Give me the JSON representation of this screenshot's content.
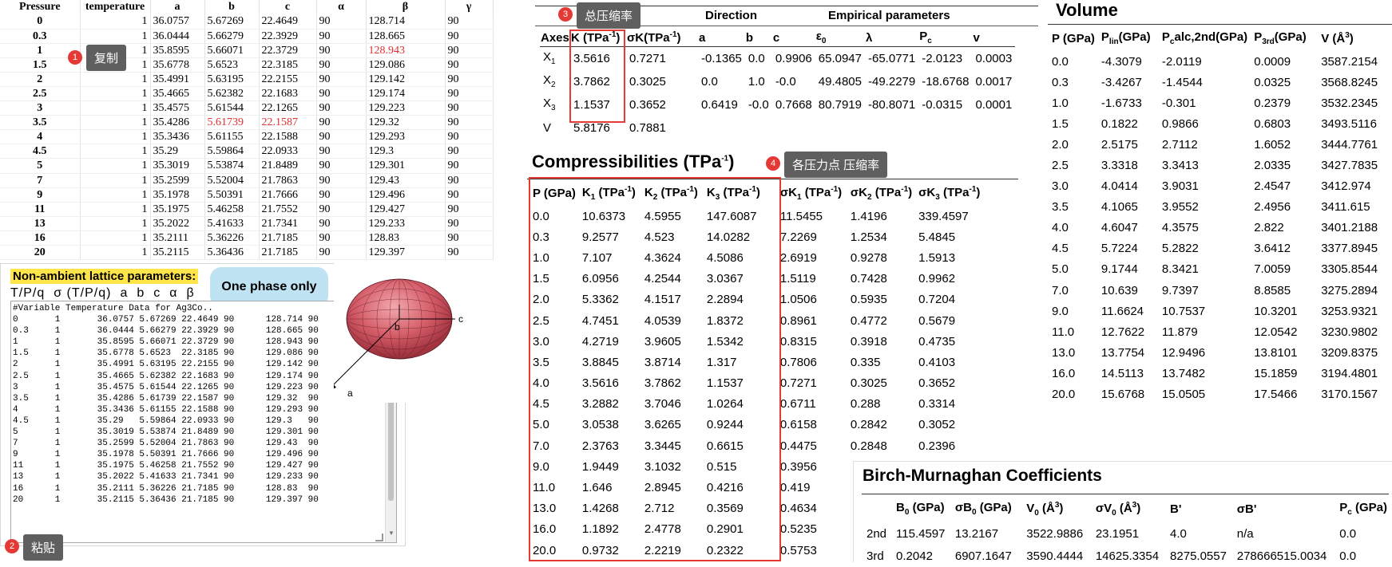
{
  "sheet": {
    "headers": [
      "Pressure",
      "temperature",
      "a",
      "b",
      "c",
      "α",
      "β",
      "γ"
    ],
    "rows": [
      [
        "0",
        "1",
        "36.0757",
        "5.67269",
        "22.4649",
        "90",
        "128.714",
        "90"
      ],
      [
        "0.3",
        "1",
        "36.0444",
        "5.66279",
        "22.3929",
        "90",
        "128.665",
        "90"
      ],
      [
        "1",
        "1",
        "35.8595",
        "5.66071",
        "22.3729",
        "90",
        "128.943",
        "90"
      ],
      [
        "1.5",
        "1",
        "35.6778",
        "5.6523",
        "22.3185",
        "90",
        "129.086",
        "90"
      ],
      [
        "2",
        "1",
        "35.4991",
        "5.63195",
        "22.2155",
        "90",
        "129.142",
        "90"
      ],
      [
        "2.5",
        "1",
        "35.4665",
        "5.62382",
        "22.1683",
        "90",
        "129.174",
        "90"
      ],
      [
        "3",
        "1",
        "35.4575",
        "5.61544",
        "22.1265",
        "90",
        "129.223",
        "90"
      ],
      [
        "3.5",
        "1",
        "35.4286",
        "5.61739",
        "22.1587",
        "90",
        "129.32",
        "90"
      ],
      [
        "4",
        "1",
        "35.3436",
        "5.61155",
        "22.1588",
        "90",
        "129.293",
        "90"
      ],
      [
        "4.5",
        "1",
        "35.29",
        "5.59864",
        "22.0933",
        "90",
        "129.3",
        "90"
      ],
      [
        "5",
        "1",
        "35.3019",
        "5.53874",
        "21.8489",
        "90",
        "129.301",
        "90"
      ],
      [
        "7",
        "1",
        "35.2599",
        "5.52004",
        "21.7863",
        "90",
        "129.43",
        "90"
      ],
      [
        "9",
        "1",
        "35.1978",
        "5.50391",
        "21.7666",
        "90",
        "129.496",
        "90"
      ],
      [
        "11",
        "1",
        "35.1975",
        "5.46258",
        "21.7552",
        "90",
        "129.427",
        "90"
      ],
      [
        "13",
        "1",
        "35.2022",
        "5.41633",
        "21.7341",
        "90",
        "129.233",
        "90"
      ],
      [
        "16",
        "1",
        "35.2111",
        "5.36226",
        "21.7185",
        "90",
        "128.83",
        "90"
      ],
      [
        "20",
        "1",
        "35.2115",
        "5.36436",
        "21.7185",
        "90",
        "129.397",
        "90"
      ]
    ]
  },
  "annotations": {
    "copy": {
      "num": "1",
      "label": "复制"
    },
    "paste": {
      "num": "2",
      "label": "粘贴"
    },
    "total": {
      "num": "3",
      "label": "总压缩率"
    },
    "axial": {
      "num": "4",
      "label": "各压力点 压缩率"
    }
  },
  "nonambient": {
    "title": "Non-ambient lattice parameters:",
    "columns": [
      "T/P/q",
      "σ (T/P/q)",
      "a",
      "b",
      "c",
      "α",
      "β"
    ],
    "bubble": "One phase only",
    "textarea": "#Variable Temperature Data for Ag3Co..\n0       1       36.0757 5.67269 22.4649 90      128.714 90\n0.3     1       36.0444 5.66279 22.3929 90      128.665 90\n1       1       35.8595 5.66071 22.3729 90      128.943 90\n1.5     1       35.6778 5.6523  22.3185 90      129.086 90\n2       1       35.4991 5.63195 22.2155 90      129.142 90\n2.5     1       35.4665 5.62382 22.1683 90      129.174 90\n3       1       35.4575 5.61544 22.1265 90      129.223 90\n3.5     1       35.4286 5.61739 22.1587 90      129.32  90\n4       1       35.3436 5.61155 22.1588 90      129.293 90\n4.5     1       35.29   5.59864 22.0933 90      129.3   90\n5       1       35.3019 5.53874 21.8489 90      129.301 90\n7       1       35.2599 5.52004 21.7863 90      129.43  90\n9       1       35.1978 5.50391 21.7666 90      129.496 90\n11      1       35.1975 5.46258 21.7552 90      129.427 90\n13      1       35.2022 5.41633 21.7341 90      129.233 90\n16      1       35.2111 5.36226 21.7185 90      128.83  90\n20      1       35.2115 5.36436 21.7185 90      129.397 90"
  },
  "ellipsoid": {
    "label_a": "a",
    "label_b": "b",
    "label_c": "c"
  },
  "principal": {
    "group_direction": "Direction",
    "group_empirical": "Empirical parameters",
    "headers": [
      "Axes",
      "K (TPa-1)",
      "σK(TPa-1)",
      "a",
      "b",
      "c",
      "ε0",
      "λ",
      "Pc",
      "v"
    ],
    "rows": [
      [
        "X1",
        "3.5616",
        "0.7271",
        "-0.1365",
        "0.0",
        "0.9906",
        "65.0947",
        "-65.0771",
        "-2.0123",
        "0.0003"
      ],
      [
        "X2",
        "3.7862",
        "0.3025",
        "0.0",
        "1.0",
        "-0.0",
        "49.4805",
        "-49.2279",
        "-18.6768",
        "0.0017"
      ],
      [
        "X3",
        "1.1537",
        "0.3652",
        "0.6419",
        "-0.0",
        "0.7668",
        "80.7919",
        "-80.8071",
        "-0.0315",
        "0.0001"
      ],
      [
        "V",
        "5.8176",
        "0.7881",
        "",
        "",
        "",
        "",
        "",
        "",
        ""
      ]
    ]
  },
  "compress": {
    "title": "Compressibilities (TPa-1)",
    "headers": [
      "P (GPa)",
      "K1 (TPa-1)",
      "K2 (TPa-1)",
      "K3 (TPa-1)",
      "σK1 (TPa-1)",
      "σK2 (TPa-1)",
      "σK3 (TPa-1)"
    ],
    "rows": [
      [
        "0.0",
        "10.6373",
        "4.5955",
        "147.6087",
        "11.5455",
        "1.4196",
        "339.4597"
      ],
      [
        "0.3",
        "9.2577",
        "4.523",
        "14.0282",
        "7.2269",
        "1.2534",
        "5.4845"
      ],
      [
        "1.0",
        "7.107",
        "4.3624",
        "4.5086",
        "2.6919",
        "0.9278",
        "1.5913"
      ],
      [
        "1.5",
        "6.0956",
        "4.2544",
        "3.0367",
        "1.5119",
        "0.7428",
        "0.9962"
      ],
      [
        "2.0",
        "5.3362",
        "4.1517",
        "2.2894",
        "1.0506",
        "0.5935",
        "0.7204"
      ],
      [
        "2.5",
        "4.7451",
        "4.0539",
        "1.8372",
        "0.8961",
        "0.4772",
        "0.5679"
      ],
      [
        "3.0",
        "4.2719",
        "3.9605",
        "1.5342",
        "0.8315",
        "0.3918",
        "0.4735"
      ],
      [
        "3.5",
        "3.8845",
        "3.8714",
        "1.317",
        "0.7806",
        "0.335",
        "0.4103"
      ],
      [
        "4.0",
        "3.5616",
        "3.7862",
        "1.1537",
        "0.7271",
        "0.3025",
        "0.3652"
      ],
      [
        "4.5",
        "3.2882",
        "3.7046",
        "1.0264",
        "0.6711",
        "0.288",
        "0.3314"
      ],
      [
        "5.0",
        "3.0538",
        "3.6265",
        "0.9244",
        "0.6158",
        "0.2842",
        "0.3052"
      ],
      [
        "7.0",
        "2.3763",
        "3.3445",
        "0.6615",
        "0.4475",
        "0.2848",
        "0.2396"
      ],
      [
        "9.0",
        "1.9449",
        "3.1032",
        "0.515",
        "0.3956",
        "",
        ""
      ],
      [
        "11.0",
        "1.646",
        "2.8945",
        "0.4216",
        "0.419",
        "",
        ""
      ],
      [
        "13.0",
        "1.4268",
        "2.712",
        "0.3569",
        "0.4634",
        "",
        ""
      ],
      [
        "16.0",
        "1.1892",
        "2.4778",
        "0.2901",
        "0.5235",
        "",
        ""
      ],
      [
        "20.0",
        "0.9732",
        "2.2219",
        "0.2322",
        "0.5753",
        "",
        ""
      ]
    ]
  },
  "volume": {
    "title": "Volume",
    "headers": [
      "P (GPa)",
      "Plin(GPa)",
      "Pcalc,2nd(GPa)",
      "P3rd(GPa)",
      "V (Å3)"
    ],
    "rows": [
      [
        "0.0",
        "-4.3079",
        "-2.0119",
        "0.0009",
        "3587.2154"
      ],
      [
        "0.3",
        "-3.4267",
        "-1.4544",
        "0.0325",
        "3568.8245"
      ],
      [
        "1.0",
        "-1.6733",
        "-0.301",
        "0.2379",
        "3532.2345"
      ],
      [
        "1.5",
        "0.1822",
        "0.9866",
        "0.6803",
        "3493.5116"
      ],
      [
        "2.0",
        "2.5175",
        "2.7112",
        "1.6052",
        "3444.7761"
      ],
      [
        "2.5",
        "3.3318",
        "3.3413",
        "2.0335",
        "3427.7835"
      ],
      [
        "3.0",
        "4.0414",
        "3.9031",
        "2.4547",
        "3412.974"
      ],
      [
        "3.5",
        "4.1065",
        "3.9552",
        "2.4956",
        "3411.615"
      ],
      [
        "4.0",
        "4.6047",
        "4.3575",
        "2.822",
        "3401.2188"
      ],
      [
        "4.5",
        "5.7224",
        "5.2822",
        "3.6412",
        "3377.8945"
      ],
      [
        "5.0",
        "9.1744",
        "8.3421",
        "7.0059",
        "3305.8544"
      ],
      [
        "7.0",
        "10.639",
        "9.7397",
        "8.8585",
        "3275.2894"
      ],
      [
        "9.0",
        "11.6624",
        "10.7537",
        "10.3201",
        "3253.9321"
      ],
      [
        "11.0",
        "12.7622",
        "11.879",
        "12.0542",
        "3230.9802"
      ],
      [
        "13.0",
        "13.7754",
        "12.9496",
        "13.8101",
        "3209.8375"
      ],
      [
        "16.0",
        "14.5113",
        "13.7482",
        "15.1859",
        "3194.4801"
      ],
      [
        "20.0",
        "15.6768",
        "15.0505",
        "17.5466",
        "3170.1567"
      ]
    ]
  },
  "birch": {
    "title": "Birch-Murnaghan Coefficients",
    "headers": [
      "",
      "B0 (GPa)",
      "σB0 (GPa)",
      "V0 (Å3)",
      "σV0 (Å3)",
      "B'",
      "σB'",
      "Pc (GPa)"
    ],
    "rows": [
      [
        "2nd",
        "115.4597",
        "13.2167",
        "3522.9886",
        "23.1951",
        "4.0",
        "n/a",
        "0.0"
      ],
      [
        "3rd",
        "0.2042",
        "6907.1647",
        "3590.4444",
        "14625.3354",
        "8275.0557",
        "278666515.0034",
        "0.0"
      ]
    ]
  }
}
